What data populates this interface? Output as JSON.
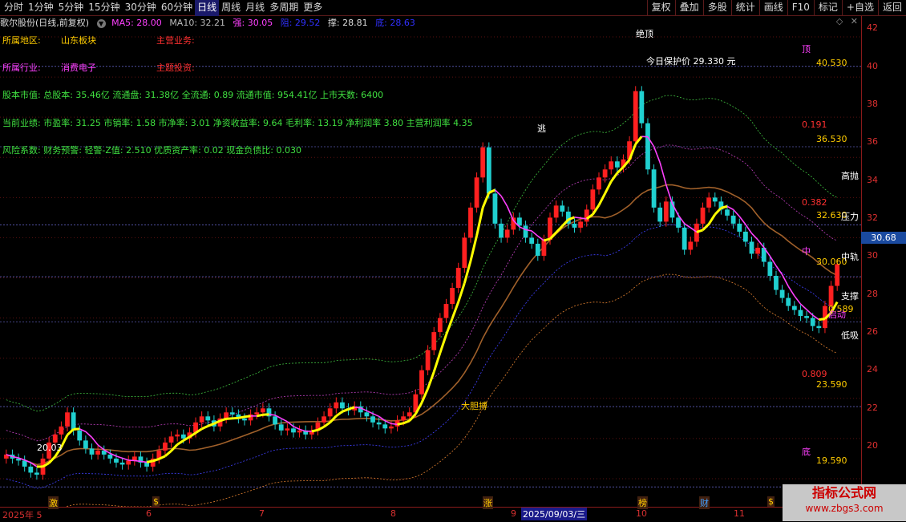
{
  "toolbar": {
    "periods": [
      "分时",
      "1分钟",
      "5分钟",
      "15分钟",
      "30分钟",
      "60分钟",
      "日线",
      "周线",
      "月线",
      "多周期",
      "更多"
    ],
    "active_period": "日线",
    "tools": [
      "复权",
      "叠加",
      "多股",
      "统计",
      "画线",
      "F10",
      "标记",
      "+自选",
      "返回"
    ]
  },
  "info": {
    "stock": "歌尔股份(日线,前复权)",
    "ma5_label": "MA5: 28.00",
    "ma10_label": "MA10: 32.21",
    "strong_label": "强: 30.05",
    "resist_label": "阻: 29.52",
    "support_label": "撑: 28.81",
    "bottom_label": "底: 28.63"
  },
  "fundamentals": {
    "region_label": "所属地区:",
    "region_value": "山东板块",
    "business_label": "主营业务:",
    "industry_label": "所属行业:",
    "industry_value": "消费电子",
    "theme_label": "主题投资:",
    "capital": "股本市值: 总股本: 35.46亿 流通盘: 31.38亿 全流通: 0.89 流通市值: 954.41亿 上市天数: 6400",
    "performance": "当前业绩: 市盈率: 31.25 市销率: 1.58 市净率: 3.01 净资收益率: 9.64 毛利率: 13.19 净利润率 3.80 主营利润率 4.35",
    "risk": "风险系数: 财务预警: 轻警-Z值: 2.510 优质资产率: 0.02 现金负债比: 0.030"
  },
  "chart_data": {
    "type": "candlestick",
    "y_axis_ticks": [
      20.0,
      22.0,
      24.0,
      26.0,
      28.0,
      30.0,
      32.0,
      34.0,
      36.0,
      38.0,
      40.0,
      42.0
    ],
    "ylim": [
      18.6,
      42.4
    ],
    "current_price": "30.68",
    "x_month_labels": [
      "2025年 5",
      "6",
      "7",
      "8",
      "9",
      "10",
      "11"
    ],
    "event_markers": [
      "激",
      "$",
      "涨",
      "榜",
      "财",
      "$"
    ],
    "selected_date": "2025/09/03/三",
    "ohlc_close": [
      21.2,
      21.0,
      20.9,
      20.6,
      20.3,
      20.2,
      21.0,
      21.8,
      22.2,
      22.6,
      23.3,
      22.4,
      21.9,
      21.5,
      21.2,
      21.4,
      21.2,
      21.0,
      20.8,
      20.7,
      20.9,
      21.1,
      20.8,
      20.6,
      21.0,
      21.4,
      21.8,
      22.1,
      22.2,
      22.0,
      22.3,
      22.8,
      23.1,
      22.9,
      22.6,
      23.0,
      23.3,
      23.2,
      23.0,
      22.9,
      23.2,
      23.3,
      23.5,
      23.1,
      22.7,
      22.4,
      22.5,
      22.3,
      22.4,
      22.2,
      22.4,
      22.8,
      23.1,
      23.5,
      23.8,
      23.5,
      23.4,
      23.6,
      23.3,
      23.1,
      22.8,
      22.7,
      22.5,
      22.6,
      22.9,
      23.1,
      23.3,
      24.2,
      25.4,
      26.4,
      27.3,
      28.0,
      28.7,
      29.5,
      30.5,
      32.0,
      33.5,
      35.0,
      36.5,
      34.2,
      32.7,
      32.0,
      32.4,
      33.0,
      32.6,
      32.0,
      31.7,
      31.1,
      31.9,
      33.0,
      33.6,
      33.3,
      32.7,
      32.5,
      32.8,
      33.4,
      34.4,
      35.0,
      35.4,
      35.8,
      35.5,
      35.9,
      36.8,
      39.3,
      37.7,
      35.4,
      33.5,
      32.8,
      33.8,
      33.0,
      32.5,
      31.4,
      31.8,
      32.7,
      33.5,
      34.0,
      33.8,
      33.4,
      33.1,
      32.7,
      32.3,
      31.8,
      31.2,
      31.5,
      30.8,
      30.1,
      29.4,
      29.0,
      28.6,
      28.4,
      28.1,
      28.0,
      27.6,
      27.5,
      28.6,
      29.6,
      30.68
    ],
    "levels": [
      {
        "name": "顶",
        "value": "40.530"
      },
      {
        "name": "",
        "value": "36.530"
      },
      {
        "name": "",
        "value": "0.191"
      },
      {
        "name": "",
        "value": "0.382"
      },
      {
        "name": "",
        "value": "32.630"
      },
      {
        "name": "",
        "value": "30.060"
      },
      {
        "name": "",
        "value": "0.809"
      },
      {
        "name": "",
        "value": "23.590"
      },
      {
        "name": "底",
        "value": "19.590"
      }
    ],
    "annotations": [
      "逃",
      "绝顶",
      "今日保护价 29.330 元",
      "大胆搏",
      "20.03",
      "高抛",
      "压力",
      "中轨",
      "支撑",
      "启动",
      "低吸",
      "中",
      "顶",
      "底",
      "0.589"
    ]
  },
  "watermark": {
    "line1": "指标公式网",
    "line2": "www.zbgs3.com"
  }
}
